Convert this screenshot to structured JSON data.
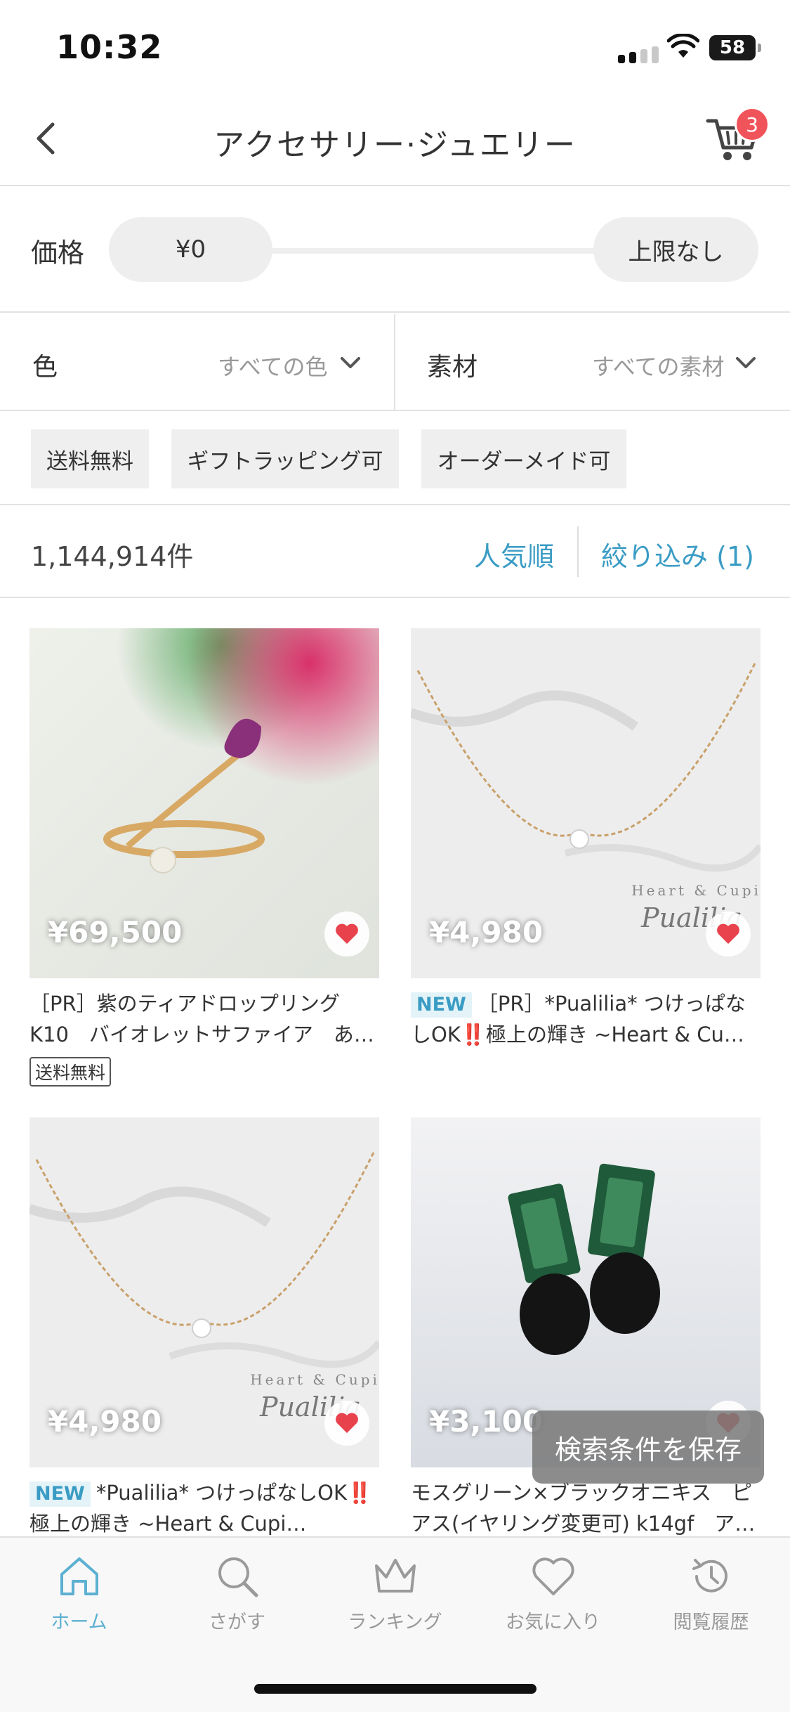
{
  "status": {
    "time": "10:32",
    "battery": "58"
  },
  "header": {
    "title": "アクセサリー·ジュエリー",
    "cart_count": "3"
  },
  "price_filter": {
    "label": "価格",
    "min": "¥0",
    "max": "上限なし"
  },
  "selects": {
    "color": {
      "label": "色",
      "value": "すべての色"
    },
    "material": {
      "label": "素材",
      "value": "すべての素材"
    }
  },
  "tags": [
    "送料無料",
    "ギフトラッピング可",
    "オーダーメイド可"
  ],
  "results": {
    "count": "1,144,914件",
    "sort": "人気順",
    "filter": "絞り込み (1)"
  },
  "products": [
    {
      "price": "¥69,500",
      "new": "",
      "name": "［PR］紫のティアドロップリング　K10　バイオレットサファイア　あ…",
      "badge": "送料無料",
      "fav": true
    },
    {
      "price": "¥4,980",
      "new": "NEW",
      "name": "［PR］*Pualilia* つけっぱなしOK‼️極上の輝き ~Heart & Cu…",
      "badge": "",
      "fav": true
    },
    {
      "price": "¥4,980",
      "new": "NEW",
      "name": "*Pualilia* つけっぱなしOK‼️極上の輝き ~Heart & Cupi…",
      "badge": "",
      "fav": true
    },
    {
      "price": "¥3,100",
      "new": "",
      "name": "モスグリーン×ブラックオニキス　ピアス(イヤリング変更可) k14gf　ア…",
      "badge": "",
      "fav": true
    }
  ],
  "image_text": {
    "brand_script": "Heart & Cupid",
    "brand_name": "Pualilia"
  },
  "toast": "検索条件を保存",
  "tabs": [
    {
      "label": "ホーム",
      "icon": "home-icon",
      "active": true
    },
    {
      "label": "さがす",
      "icon": "search-icon",
      "active": false
    },
    {
      "label": "ランキング",
      "icon": "crown-icon",
      "active": false
    },
    {
      "label": "お気に入り",
      "icon": "heart-icon",
      "active": false
    },
    {
      "label": "閲覧履歴",
      "icon": "history-icon",
      "active": false
    }
  ],
  "colors": {
    "accent": "#3a9cc4",
    "tab_active": "#5cb0d1",
    "badge": "#f0545a",
    "heart": "#e8424d"
  }
}
